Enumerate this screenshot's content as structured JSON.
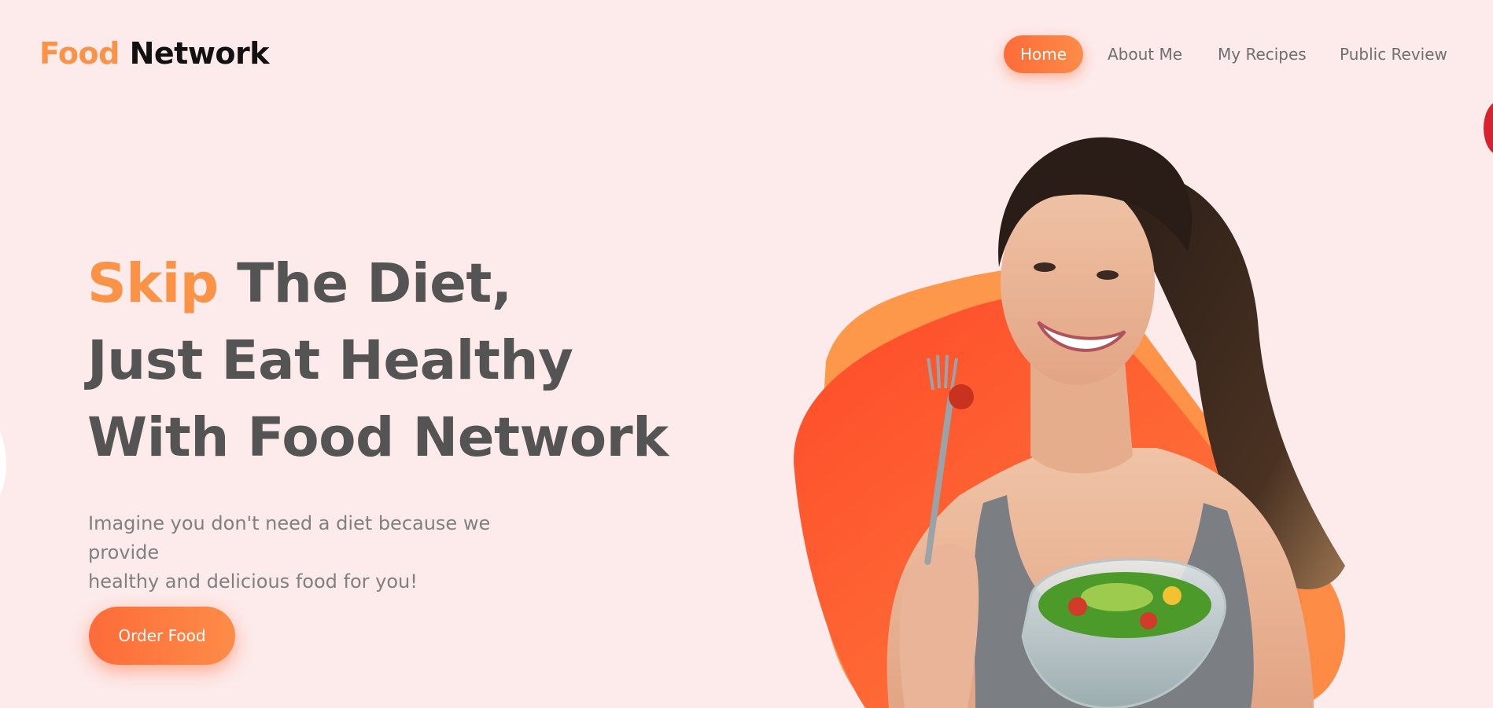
{
  "header": {
    "logo_accent": "Food",
    "logo_rest": "Network"
  },
  "nav": {
    "items": [
      {
        "label": "Home",
        "active": true
      },
      {
        "label": "About Me",
        "active": false
      },
      {
        "label": "My Recipes",
        "active": false
      },
      {
        "label": "Public Review",
        "active": false
      }
    ]
  },
  "hero": {
    "title_accent": "Skip",
    "title_line1_rest": "The Diet,",
    "title_line2": "Just Eat Healthy",
    "title_line3": "With Food Network",
    "description_line1": "Imagine you don't need a diet because we provide",
    "description_line2": "healthy and delicious food for you!",
    "cta_label": "Order Food"
  },
  "colors": {
    "background": "#fdeaea",
    "accent": "#fb9347",
    "button_gradient_start": "#fd6b39",
    "button_gradient_end": "#fd8c48",
    "heading": "#545454",
    "body_text": "#808080"
  },
  "images": {
    "hero_image": "woman-eating-salad-image"
  }
}
